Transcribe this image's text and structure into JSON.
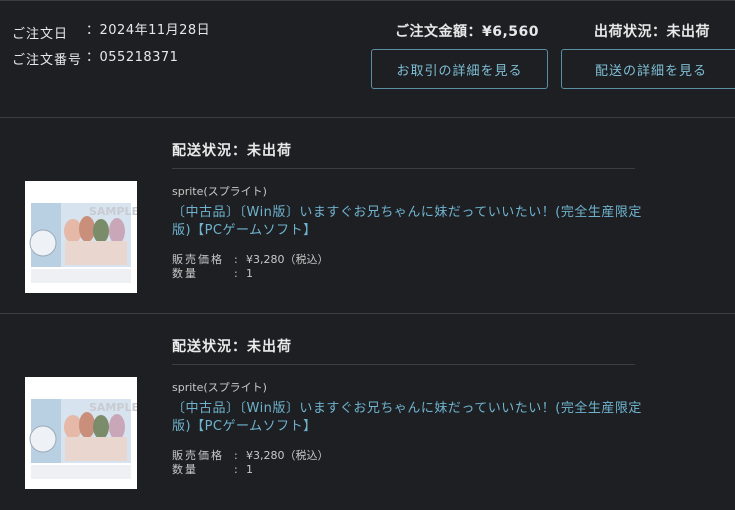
{
  "order": {
    "date_label": "ご注文日",
    "date_value": "：2024年11月28日",
    "number_label": "ご注文番号",
    "number_value": "：055218371",
    "total_text": "ご注文金額：¥6,560",
    "ship_status_text": "出荷状況：未出荷",
    "btn_transaction": "お取引の詳細を見る",
    "btn_shipping": "配送の詳細を見る"
  },
  "items": [
    {
      "status": "配送状況：未出荷",
      "thumb_badge": "SAMPLE",
      "brand": "sprite(スプライト)",
      "title": "〔中古品〕〔Win版〕いますぐお兄ちゃんに妹だっていいたい！(完全生産限定版)【PCゲームソフト】",
      "price_label": "販売価格",
      "price_value": "¥3,280（税込）",
      "qty_label": "数量",
      "qty_value": "1"
    },
    {
      "status": "配送状況：未出荷",
      "thumb_badge": "SAMPLE",
      "brand": "sprite(スプライト)",
      "title": "〔中古品〕〔Win版〕いますぐお兄ちゃんに妹だっていいたい！(完全生産限定版)【PCゲームソフト】",
      "price_label": "販売価格",
      "price_value": "¥3,280（税込）",
      "qty_label": "数量",
      "qty_value": "1"
    }
  ],
  "colors": {
    "background": "#1d1f22",
    "accent": "#6fb3cf",
    "border": "#3a3d42"
  }
}
